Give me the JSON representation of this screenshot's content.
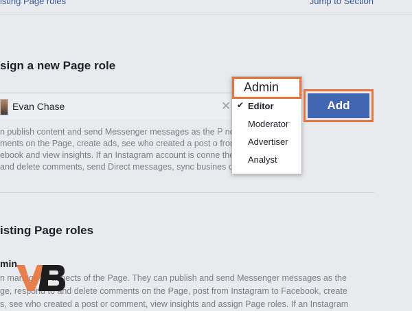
{
  "topbar": {
    "left_text": "isting Page roles",
    "right_text": "Jump to Section"
  },
  "assign": {
    "title": "sign a new Page role",
    "user_name": "Evan Chase",
    "description_lines": [
      "n publish content and send Messenger messages as the P           nd delete",
      "ments on the Page, create ads, see who created a post o           from Instagram to",
      "ebook and view insights. If an Instagram account is conne          they can respond",
      "and delete comments, send Direct messages, sync busines          create ads."
    ]
  },
  "dropdown": {
    "selected_display": "Admin",
    "options": [
      "Editor",
      "Moderator",
      "Advertiser",
      "Analyst"
    ],
    "checked_option": "Editor"
  },
  "add_button_label": "Add",
  "existing": {
    "title": "isting Page roles",
    "admin_heading": "min",
    "description_lines": [
      "n manage all aspects of the Page. They can publish and send Messenger messages as the",
      "ge, respond to and delete comments on the Page, post from Instagram to Facebook, create",
      "s, see who created a post or comment, view insights and assign Page roles. If an Instagram"
    ]
  },
  "colors": {
    "accent_orange": "#e8743b",
    "button_blue": "#4267b2",
    "link_blue": "#365899"
  },
  "icons": [
    "clear-icon",
    "checkmark-icon",
    "avatar"
  ]
}
